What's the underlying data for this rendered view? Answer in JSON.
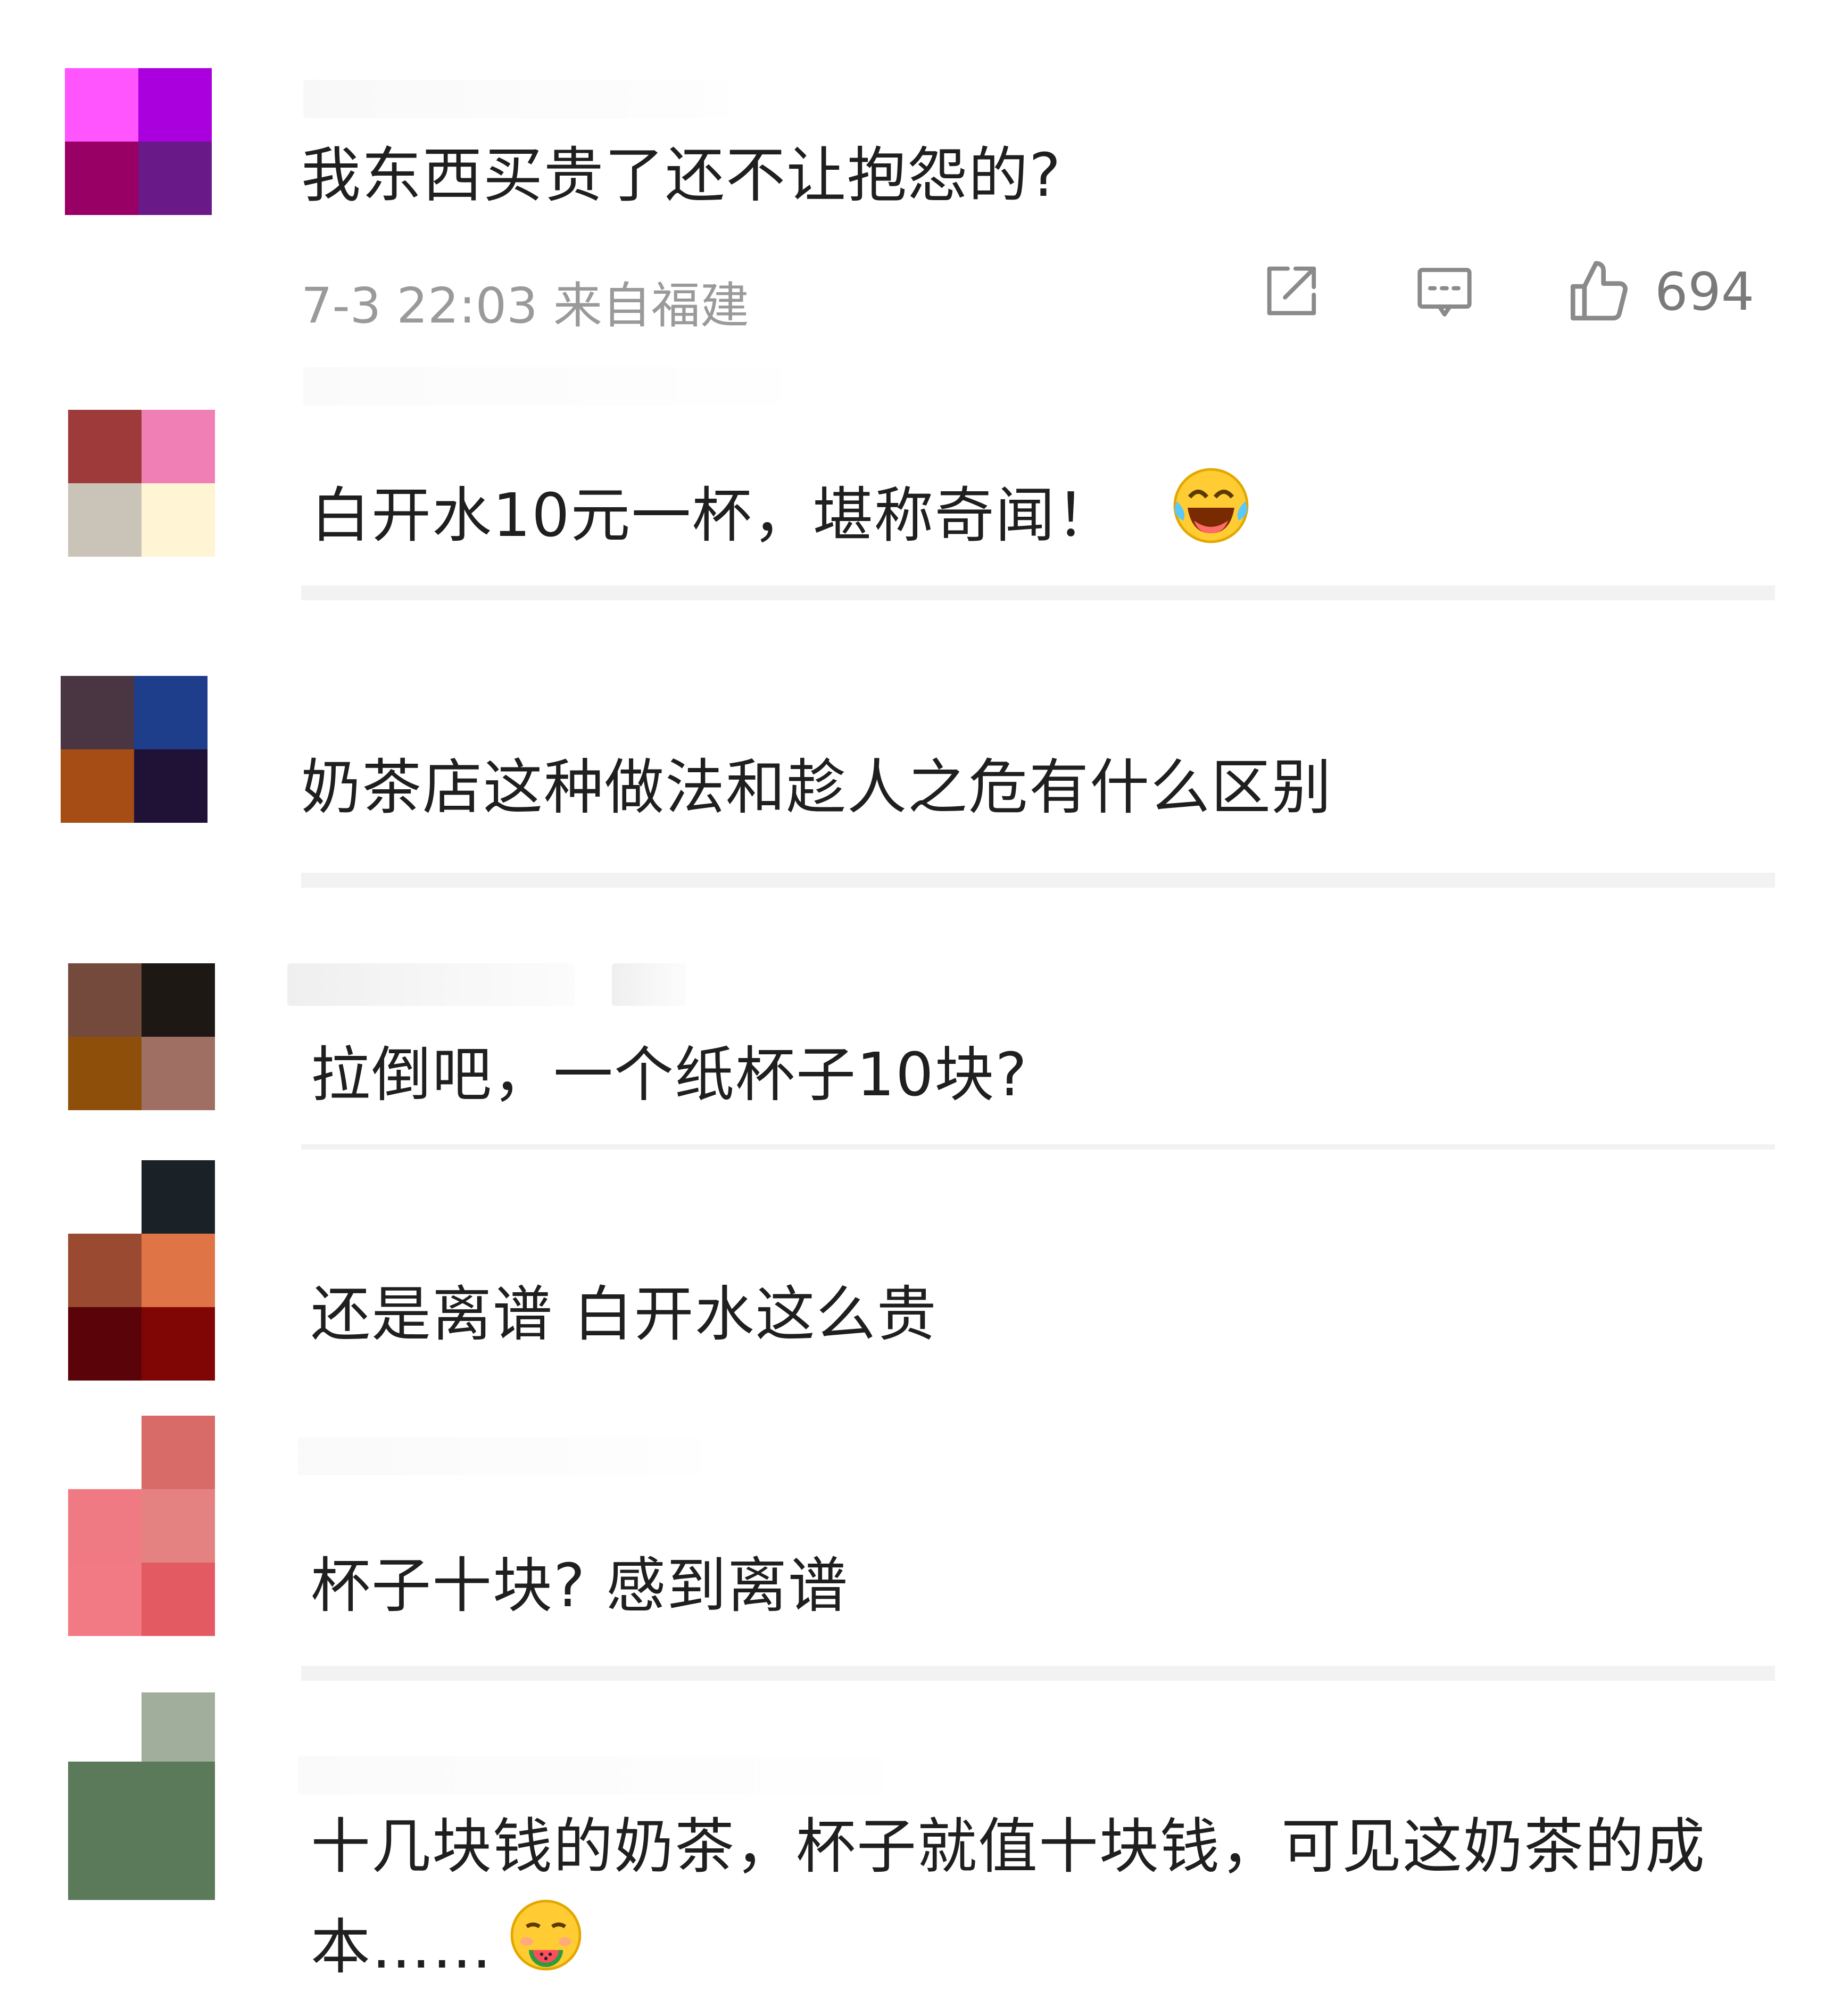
{
  "comments": [
    {
      "text": "我东西买贵了还不让抱怨的?",
      "meta": "7-3 22:03 来自福建",
      "likes": "694",
      "avatar_colors": [
        "#ff55ff",
        "#aa00dd",
        "#990066",
        "#6a1a88"
      ]
    },
    {
      "text": "白开水10元一杯，堪称奇闻！",
      "emoji": "laughing-tears-emoji",
      "avatar_colors": [
        "#9e3a3a",
        "#f07fb5",
        "#c9c3b8",
        "#fff5d4"
      ]
    },
    {
      "text": "奶茶店这种做法和趁人之危有什么区别",
      "avatar_colors": [
        "#4a3542",
        "#1e3d8a",
        "#a54d14",
        "#1f1236"
      ]
    },
    {
      "text": "拉倒吧，一个纸杯子10块?",
      "avatar_colors": [
        "#744a3d",
        "#1e1814",
        "#8e4f0b",
        "#9e6f62"
      ]
    },
    {
      "text": "还是离谱  白开水这么贵",
      "avatar_colors": [
        "#9b4a32",
        "#df7447",
        "#5a0309",
        "#800606"
      ]
    },
    {
      "text": "杯子十块?  感到离谱",
      "avatar_colors": [
        "#f07a83",
        "#e48282",
        "#f17a84",
        "#e45a62"
      ]
    },
    {
      "text": "十几块钱的奶茶，杯子就值十块钱，可见这奶茶的成本……",
      "emoji": "eating-watermelon-emoji",
      "avatar_colors": [
        "#5a7a5a",
        "#a1ae9c",
        "#5a7a5a",
        "#5a7a5a"
      ]
    }
  ],
  "icons": {
    "share": "share-icon",
    "comment": "comment-icon",
    "like": "thumbs-up-icon"
  }
}
